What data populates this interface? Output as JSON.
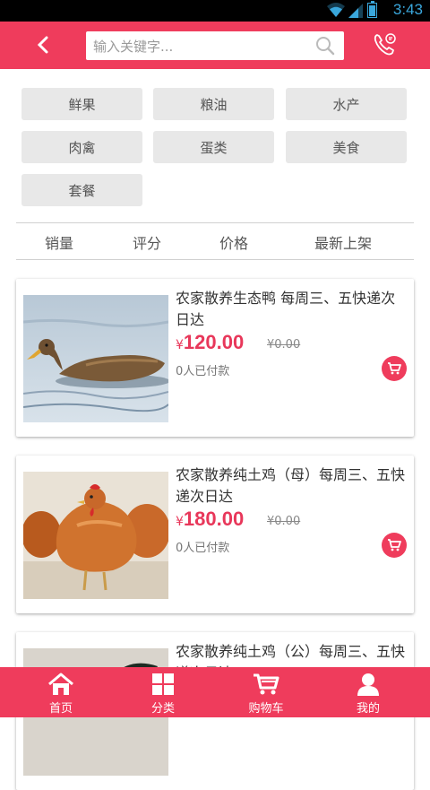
{
  "status_bar": {
    "time": "3:43"
  },
  "header": {
    "search_placeholder": "输入关键字..."
  },
  "categories": [
    "鲜果",
    "粮油",
    "水产",
    "肉禽",
    "蛋类",
    "美食",
    "套餐"
  ],
  "sort_options": [
    "销量",
    "评分",
    "价格",
    "最新上架"
  ],
  "products": [
    {
      "title": "农家散养生态鸭 每周三、五快递次日达",
      "currency": "¥",
      "price": "120.00",
      "old_price": "¥0.00",
      "paid": "0人已付款"
    },
    {
      "title": "农家散养纯土鸡（母）每周三、五快递次日达",
      "currency": "¥",
      "price": "180.00",
      "old_price": "¥0.00",
      "paid": "0人已付款"
    },
    {
      "title": "农家散养纯土鸡（公）每周三、五快递次日达"
    }
  ],
  "bottom_nav": [
    "首页",
    "分类",
    "购物车",
    "我的"
  ],
  "colors": {
    "brand": "#ef3c5c",
    "price": "#e8375a"
  }
}
